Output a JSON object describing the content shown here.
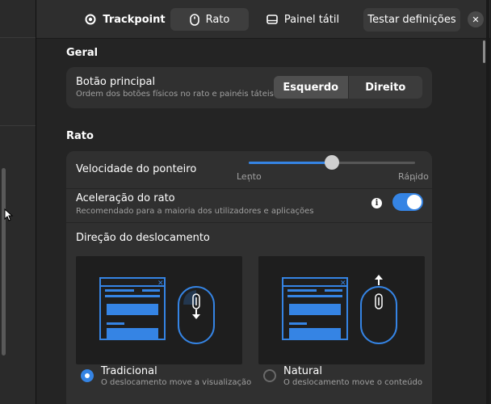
{
  "header": {
    "tabs": [
      {
        "label": "Trackpoint",
        "icon": "trackpoint-icon"
      },
      {
        "label": "Rato",
        "icon": "mouse-icon"
      },
      {
        "label": "Painel tátil",
        "icon": "touchpad-icon"
      }
    ],
    "test_button": "Testar definições",
    "close_icon": "close-icon",
    "active_tab": "Rato"
  },
  "general": {
    "title": "Geral",
    "primary_button": {
      "label": "Botão principal",
      "description": "Ordem dos botões físicos no rato e painéis táteis.",
      "options": [
        "Esquerdo",
        "Direito"
      ],
      "selected": "Esquerdo"
    }
  },
  "mouse": {
    "title": "Rato",
    "pointer_speed": {
      "label": "Velocidade do ponteiro",
      "min_label": "Lento",
      "max_label": "Rápido",
      "value_fraction": 0.5
    },
    "acceleration": {
      "label": "Aceleração do rato",
      "description": "Recomendado para a maioria dos utilizadores e aplicações",
      "enabled": true,
      "info_icon": "info-icon"
    },
    "scroll_direction": {
      "label": "Direção do deslocamento",
      "options": [
        {
          "label": "Tradicional",
          "description": "O deslocamento move a visualização",
          "selected": true
        },
        {
          "label": "Natural",
          "description": "O deslocamento move o conteúdo",
          "selected": false
        }
      ]
    }
  },
  "colors": {
    "accent": "#3584e4",
    "background": "#242424",
    "card": "#303030",
    "header": "#2e2e2e"
  }
}
